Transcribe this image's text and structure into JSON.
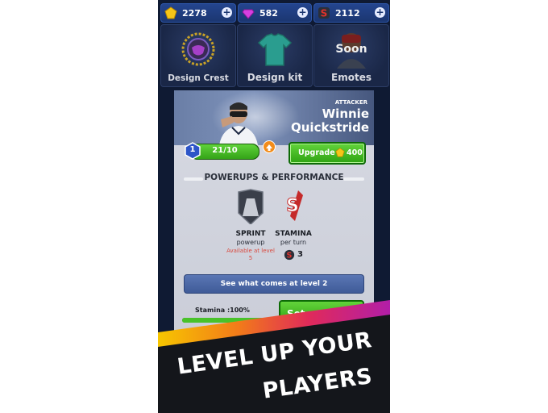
{
  "currencies": [
    {
      "icon": "coin-icon",
      "value": "2278",
      "color": "#f5c518"
    },
    {
      "icon": "gem-icon",
      "value": "582",
      "color": "#d63fe0"
    },
    {
      "icon": "s-token-icon",
      "value": "2112",
      "color": "#d9322b"
    }
  ],
  "tiles": [
    {
      "label": "Design Crest",
      "icon": "crest-icon"
    },
    {
      "label": "Design kit",
      "icon": "jersey-icon"
    },
    {
      "label": "Emotes",
      "icon": "emote-avatar-icon",
      "overlay": "Soon"
    }
  ],
  "player": {
    "position": "ATTACKER",
    "first_name": "Winnie",
    "last_name": "Quickstride",
    "level": "1",
    "xp_text": "21/10",
    "xp_progress": 1.0
  },
  "upgrade": {
    "label": "Upgrade",
    "cost": "400",
    "cost_icon": "coin-icon"
  },
  "section_title": "POWERUPS & PERFORMANCE",
  "powerups": [
    {
      "name": "SPRINT",
      "sub": "powerup",
      "availability": "Available at level 5",
      "icon": "sprint-shield-icon"
    },
    {
      "name": "STAMINA",
      "sub": "per turn",
      "value": "3",
      "icon": "s-token-icon"
    }
  ],
  "see_more_label": "See what comes at level 2",
  "stamina": {
    "label": "Stamina :100%",
    "progress": 1.0
  },
  "set_position_label": "Set positi",
  "banner": {
    "line1": "LEVEL UP YOUR",
    "line2": "PLAYERS"
  },
  "colors": {
    "accent_green": "#3fbf1f",
    "panel_bg": "#d3d6df",
    "brand_red": "#e0322b"
  }
}
